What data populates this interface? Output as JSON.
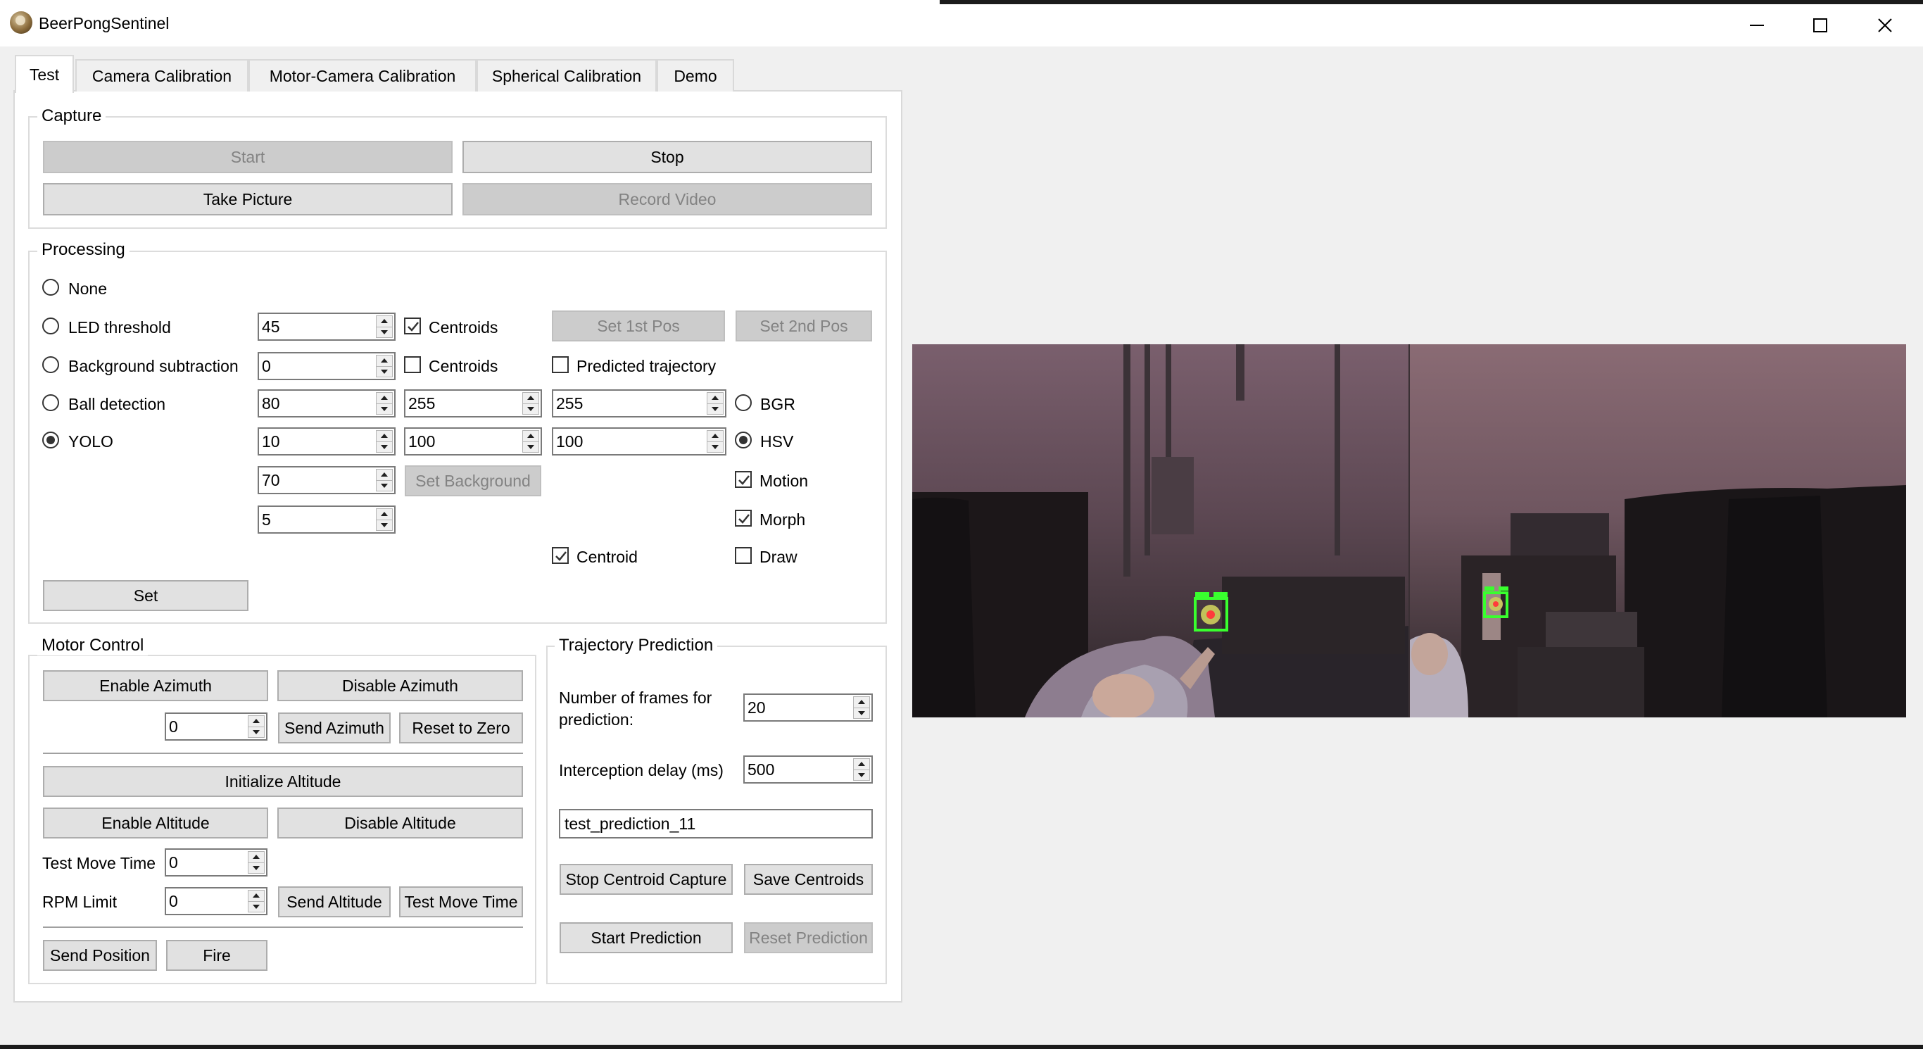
{
  "window": {
    "title": "BeerPongSentinel",
    "controls": [
      "minimize",
      "maximize",
      "close"
    ]
  },
  "tabs": [
    {
      "label": "Test",
      "active": true
    },
    {
      "label": "Camera Calibration",
      "active": false
    },
    {
      "label": "Motor-Camera Calibration",
      "active": false
    },
    {
      "label": "Spherical Calibration",
      "active": false
    },
    {
      "label": "Demo",
      "active": false
    }
  ],
  "capture": {
    "title": "Capture",
    "start": {
      "label": "Start",
      "enabled": false
    },
    "stop": {
      "label": "Stop",
      "enabled": true
    },
    "take_picture": {
      "label": "Take Picture",
      "enabled": true
    },
    "record_video": {
      "label": "Record Video",
      "enabled": false
    }
  },
  "processing": {
    "title": "Processing",
    "modes": [
      {
        "label": "None",
        "selected": false
      },
      {
        "label": "LED threshold",
        "selected": false
      },
      {
        "label": "Background subtraction",
        "selected": false
      },
      {
        "label": "Ball detection",
        "selected": false
      },
      {
        "label": "YOLO",
        "selected": true
      }
    ],
    "led_threshold": "45",
    "led_centroids": {
      "label": "Centroids",
      "checked": true
    },
    "bg_value": "0",
    "bg_centroids": {
      "label": "Centroids",
      "checked": false
    },
    "set_1st_pos": {
      "label": "Set 1st Pos",
      "enabled": false
    },
    "set_2nd_pos": {
      "label": "Set 2nd Pos",
      "enabled": false
    },
    "predicted_trajectory": {
      "label": "Predicted trajectory",
      "checked": false
    },
    "ball_row": [
      "80",
      "255",
      "255"
    ],
    "yolo_row": [
      "10",
      "100",
      "100"
    ],
    "color_space": [
      {
        "label": "BGR",
        "selected": false
      },
      {
        "label": "HSV",
        "selected": true
      }
    ],
    "value_70": "70",
    "value_5": "5",
    "set_background": {
      "label": "Set Background",
      "enabled": false
    },
    "motion": {
      "label": "Motion",
      "checked": true
    },
    "morph": {
      "label": "Morph",
      "checked": true
    },
    "centroid": {
      "label": "Centroid",
      "checked": true
    },
    "draw": {
      "label": "Draw",
      "checked": false
    },
    "set": {
      "label": "Set"
    }
  },
  "motor": {
    "title": "Motor Control",
    "enable_azimuth": "Enable Azimuth",
    "disable_azimuth": "Disable Azimuth",
    "azimuth_value": "0",
    "send_azimuth": "Send Azimuth",
    "reset_to_zero": "Reset to Zero",
    "initialize_altitude": "Initialize Altitude",
    "enable_altitude": "Enable Altitude",
    "disable_altitude": "Disable Altitude",
    "test_move_time_label": "Test Move Time",
    "test_move_time_value": "0",
    "rpm_limit_label": "RPM Limit",
    "rpm_limit_value": "0",
    "send_altitude": "Send Altitude",
    "test_move_time_button": "Test Move Time",
    "send_position": "Send Position",
    "fire": "Fire"
  },
  "trajectory": {
    "title": "Trajectory Prediction",
    "frames_label": "Number of frames for prediction:",
    "frames_value": "20",
    "delay_label": "Interception delay (ms)",
    "delay_value": "500",
    "filename": "test_prediction_11",
    "stop_centroid_capture": {
      "label": "Stop Centroid Capture",
      "enabled": true
    },
    "save_centroids": {
      "label": "Save Centroids",
      "enabled": true
    },
    "start_prediction": {
      "label": "Start Prediction",
      "enabled": true
    },
    "reset_prediction": {
      "label": "Reset Prediction",
      "enabled": false
    }
  },
  "camera": {
    "box_color": "#39ff2e"
  }
}
